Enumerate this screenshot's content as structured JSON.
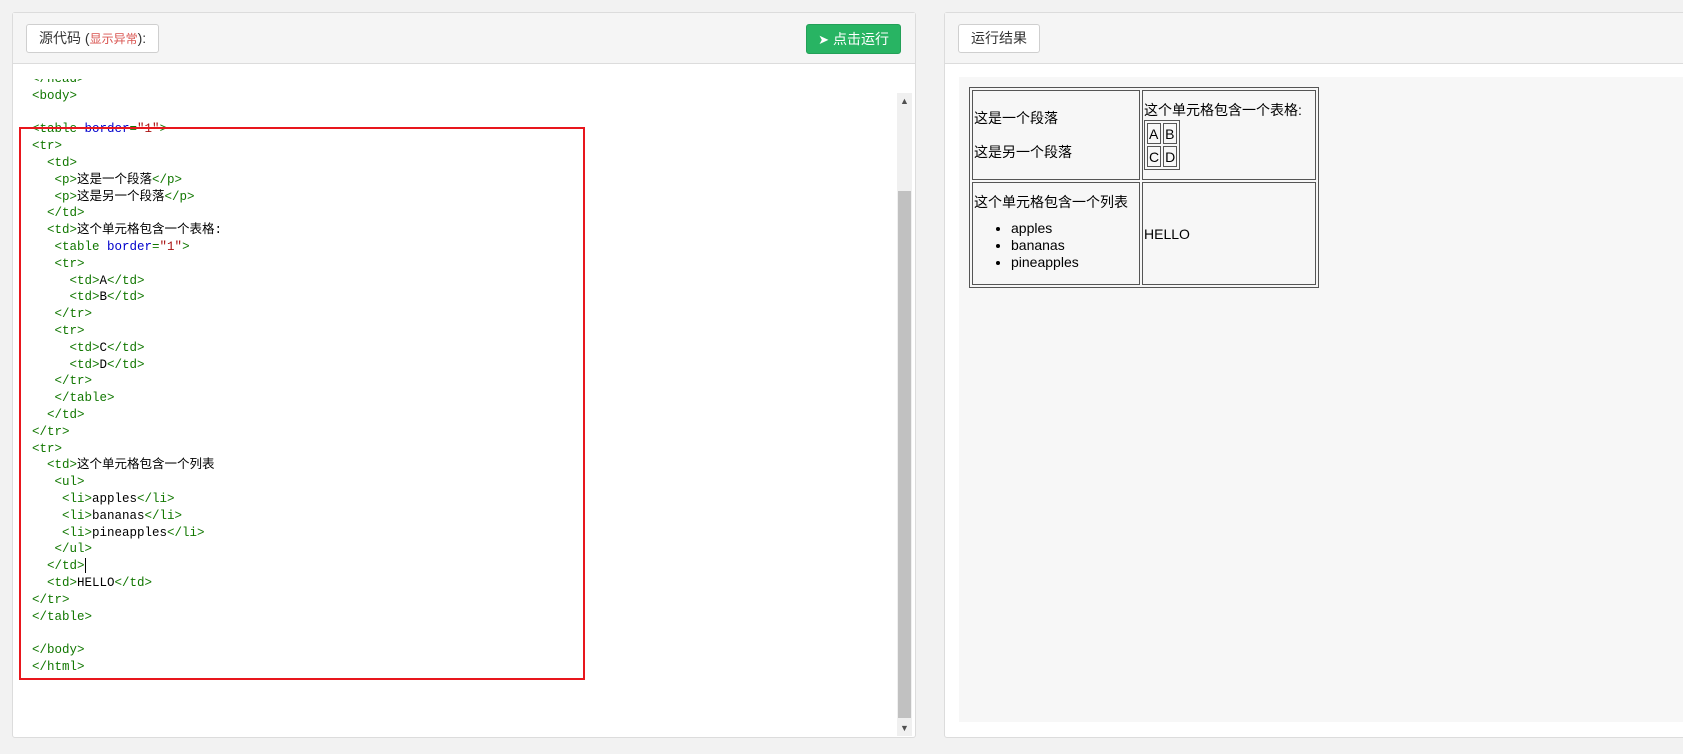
{
  "left_panel": {
    "source_label": "源代码 (",
    "source_warning": "显示异常",
    "source_suffix": "):",
    "run_button": "点击运行",
    "code_lines": [
      [
        {
          "c": "tg",
          "t": "</head>"
        }
      ],
      [
        {
          "c": "tg",
          "t": "<body>"
        }
      ],
      [],
      [
        {
          "c": "tg",
          "t": "<table "
        },
        {
          "c": "at",
          "t": "border"
        },
        {
          "c": "tg",
          "t": "="
        },
        {
          "c": "sv",
          "t": "\"1\""
        },
        {
          "c": "tg",
          "t": ">"
        }
      ],
      [
        {
          "c": "tg",
          "t": "<tr>"
        }
      ],
      [
        {
          "c": "tg",
          "t": "  <td>"
        }
      ],
      [
        {
          "c": "tg",
          "t": "   <p>"
        },
        {
          "c": "",
          "t": "这是一个段落"
        },
        {
          "c": "tg",
          "t": "</p>"
        }
      ],
      [
        {
          "c": "tg",
          "t": "   <p>"
        },
        {
          "c": "",
          "t": "这是另一个段落"
        },
        {
          "c": "tg",
          "t": "</p>"
        }
      ],
      [
        {
          "c": "tg",
          "t": "  </td>"
        }
      ],
      [
        {
          "c": "tg",
          "t": "  <td>"
        },
        {
          "c": "",
          "t": "这个单元格包含一个表格:"
        }
      ],
      [
        {
          "c": "tg",
          "t": "   <table "
        },
        {
          "c": "at",
          "t": "border"
        },
        {
          "c": "tg",
          "t": "="
        },
        {
          "c": "sv",
          "t": "\"1\""
        },
        {
          "c": "tg",
          "t": ">"
        }
      ],
      [
        {
          "c": "tg",
          "t": "   <tr>"
        }
      ],
      [
        {
          "c": "tg",
          "t": "     <td>"
        },
        {
          "c": "",
          "t": "A"
        },
        {
          "c": "tg",
          "t": "</td>"
        }
      ],
      [
        {
          "c": "tg",
          "t": "     <td>"
        },
        {
          "c": "",
          "t": "B"
        },
        {
          "c": "tg",
          "t": "</td>"
        }
      ],
      [
        {
          "c": "tg",
          "t": "   </tr>"
        }
      ],
      [
        {
          "c": "tg",
          "t": "   <tr>"
        }
      ],
      [
        {
          "c": "tg",
          "t": "     <td>"
        },
        {
          "c": "",
          "t": "C"
        },
        {
          "c": "tg",
          "t": "</td>"
        }
      ],
      [
        {
          "c": "tg",
          "t": "     <td>"
        },
        {
          "c": "",
          "t": "D"
        },
        {
          "c": "tg",
          "t": "</td>"
        }
      ],
      [
        {
          "c": "tg",
          "t": "   </tr>"
        }
      ],
      [
        {
          "c": "tg",
          "t": "   </table>"
        }
      ],
      [
        {
          "c": "tg",
          "t": "  </td>"
        }
      ],
      [
        {
          "c": "tg",
          "t": "</tr>"
        }
      ],
      [
        {
          "c": "tg",
          "t": "<tr>"
        }
      ],
      [
        {
          "c": "tg",
          "t": "  <td>"
        },
        {
          "c": "",
          "t": "这个单元格包含一个列表"
        }
      ],
      [
        {
          "c": "tg",
          "t": "   <ul>"
        }
      ],
      [
        {
          "c": "tg",
          "t": "    <li>"
        },
        {
          "c": "",
          "t": "apples"
        },
        {
          "c": "tg",
          "t": "</li>"
        }
      ],
      [
        {
          "c": "tg",
          "t": "    <li>"
        },
        {
          "c": "",
          "t": "bananas"
        },
        {
          "c": "tg",
          "t": "</li>"
        }
      ],
      [
        {
          "c": "tg",
          "t": "    <li>"
        },
        {
          "c": "",
          "t": "pineapples"
        },
        {
          "c": "tg",
          "t": "</li>"
        }
      ],
      [
        {
          "c": "tg",
          "t": "   </ul>"
        }
      ],
      [
        {
          "c": "tg",
          "t": "  </td>"
        },
        {
          "c": "cursor",
          "t": ""
        }
      ],
      [
        {
          "c": "tg",
          "t": "  <td>"
        },
        {
          "c": "",
          "t": "HELLO"
        },
        {
          "c": "tg",
          "t": "</td>"
        }
      ],
      [
        {
          "c": "tg",
          "t": "</tr>"
        }
      ],
      [
        {
          "c": "tg",
          "t": "</table>"
        }
      ],
      [],
      [
        {
          "c": "tg",
          "t": "</body>"
        }
      ],
      [
        {
          "c": "tg",
          "t": "</html>"
        }
      ]
    ]
  },
  "right_panel": {
    "result_label": "运行结果",
    "result": {
      "para1": "这是一个段落",
      "para2": "这是另一个段落",
      "table_caption": "这个单元格包含一个表格:",
      "inner_cells": [
        "A",
        "B",
        "C",
        "D"
      ],
      "list_caption": "这个单元格包含一个列表",
      "list_items": [
        "apples",
        "bananas",
        "pineapples"
      ],
      "hello": "HELLO"
    }
  },
  "colors": {
    "tag": "#117700",
    "attribute": "#0000cc",
    "string": "#aa1111",
    "run_button": "#28b463",
    "highlight": "#e8161d"
  },
  "icons": {
    "run_button_icon": "paper-plane-icon"
  }
}
